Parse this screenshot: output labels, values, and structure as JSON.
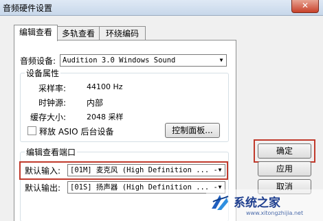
{
  "window": {
    "title": "音频硬件设置",
    "close_label": "✕"
  },
  "tabs": [
    {
      "label": "编辑查看",
      "active": true
    },
    {
      "label": "多轨查看",
      "active": false
    },
    {
      "label": "环绕编码",
      "active": false
    }
  ],
  "audio_device": {
    "label": "音频设备:",
    "value": "Audition 3.0 Windows Sound"
  },
  "device_properties": {
    "group_title": "设备属性",
    "sample_rate_label": "采样率:",
    "sample_rate_value": "44100 Hz",
    "clock_source_label": "时钟源:",
    "clock_source_value": "内部",
    "buffer_size_label": "缓存大小:",
    "buffer_size_value": "2048 采样",
    "release_asio_label": "释放 ASIO 后台设备",
    "release_asio_checked": false,
    "control_panel_button": "控制面板..."
  },
  "edit_view_port": {
    "group_title": "编辑查看端口",
    "default_input_label": "默认输入:",
    "default_input_value": "[01M] 麦克风 (High Definition ... -",
    "default_output_label": "默认输出:",
    "default_output_value": "[01S] 扬声器 (High Definition ... -"
  },
  "buttons": {
    "ok": "确定",
    "apply": "应用",
    "cancel": "取消"
  },
  "watermark": {
    "text": "系统之家",
    "url": "www.xitongzhijia.net"
  },
  "colors": {
    "highlight": "#c0392b",
    "title_gradient_top": "#dfe9f5",
    "close_button": "#c8412a"
  }
}
